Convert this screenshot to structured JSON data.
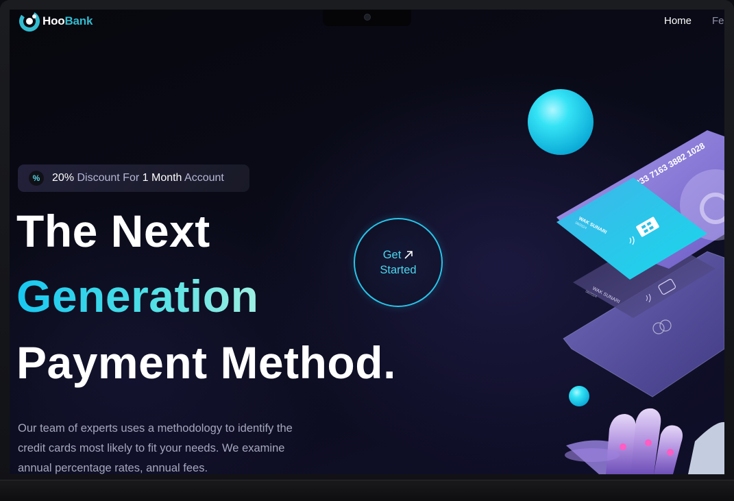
{
  "brand": {
    "name_part1": "Hoo",
    "name_part2": "Bank",
    "accent": "#33bbcf"
  },
  "nav": {
    "items": [
      {
        "label": "Home",
        "active": true
      },
      {
        "label": "Fe",
        "active": false
      }
    ]
  },
  "promo": {
    "icon": "discount-icon",
    "icon_glyph": "%",
    "percent": "20%",
    "discount_for": "Discount For",
    "duration": "1 Month",
    "account": "Account"
  },
  "hero": {
    "line1": "The Next",
    "line2": "Generation",
    "line3": "Payment Method.",
    "description": "Our team of experts uses a methodology to identify the credit cards most likely to fit your needs. We examine annual percentage rates, annual fees."
  },
  "cta": {
    "line1": "Get",
    "line2": "Started",
    "icon": "arrow-up-right-icon"
  },
  "cards": {
    "number": "1833 7163 3882 1028",
    "holder": "WAK SUNARI",
    "expiry": "06/2024"
  },
  "colors": {
    "background": "#0a0b19",
    "gradient_start": "#17c7f0",
    "gradient_end": "#9ef0e2",
    "card_purple": "#8f7fd8",
    "card_cyan": "#23cde8"
  }
}
